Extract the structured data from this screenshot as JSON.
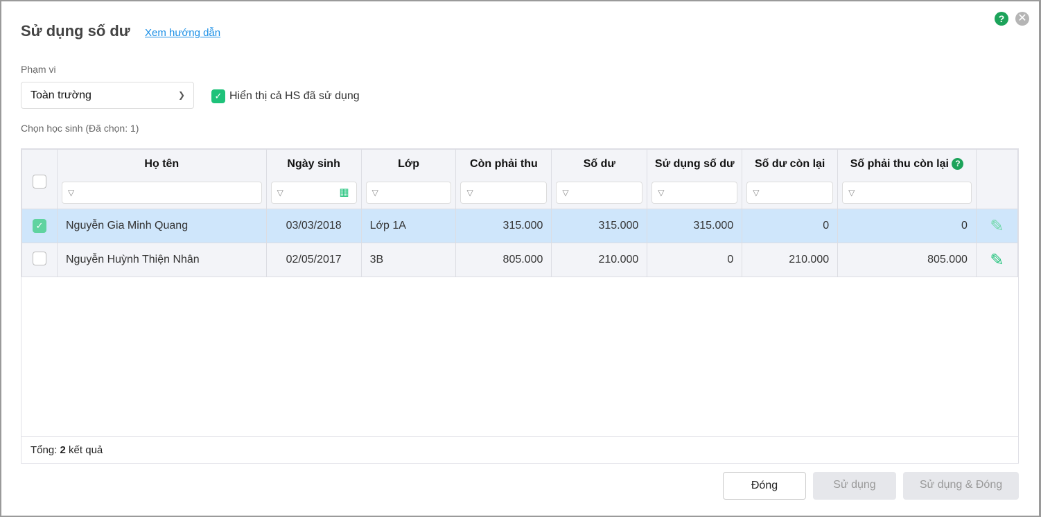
{
  "title": "Sử dụng số dư",
  "guide_link": "Xem hướng dẫn",
  "scope_label": "Phạm vi",
  "scope_value": "Toàn trường",
  "show_used_label": "Hiển thị cả HS đã sử dụng",
  "select_label": "Chọn học sinh (Đã chọn: 1)",
  "columns": [
    "Họ tên",
    "Ngày sinh",
    "Lớp",
    "Còn phải thu",
    "Số dư",
    "Sử dụng số dư",
    "Số dư còn lại",
    "Số phải thu còn lại"
  ],
  "rows": [
    {
      "checked": true,
      "name": "Nguyễn Gia Minh Quang",
      "dob": "03/03/2018",
      "class": "Lớp 1A",
      "due": "315.000",
      "balance": "315.000",
      "use": "315.000",
      "balance_left": "0",
      "due_left": "0"
    },
    {
      "checked": false,
      "name": "Nguyễn Huỳnh Thiện Nhân",
      "dob": "02/05/2017",
      "class": "3B",
      "due": "805.000",
      "balance": "210.000",
      "use": "0",
      "balance_left": "210.000",
      "due_left": "805.000"
    }
  ],
  "footer": {
    "prefix": "Tổng:",
    "count": "2",
    "suffix": "kết quả"
  },
  "buttons": {
    "close": "Đóng",
    "use": "Sử dụng",
    "use_close": "Sử dụng & Đóng"
  },
  "colors": {
    "accent": "#1ec27a",
    "link": "#1a8fe6",
    "selected_row": "#cfe6fb"
  }
}
